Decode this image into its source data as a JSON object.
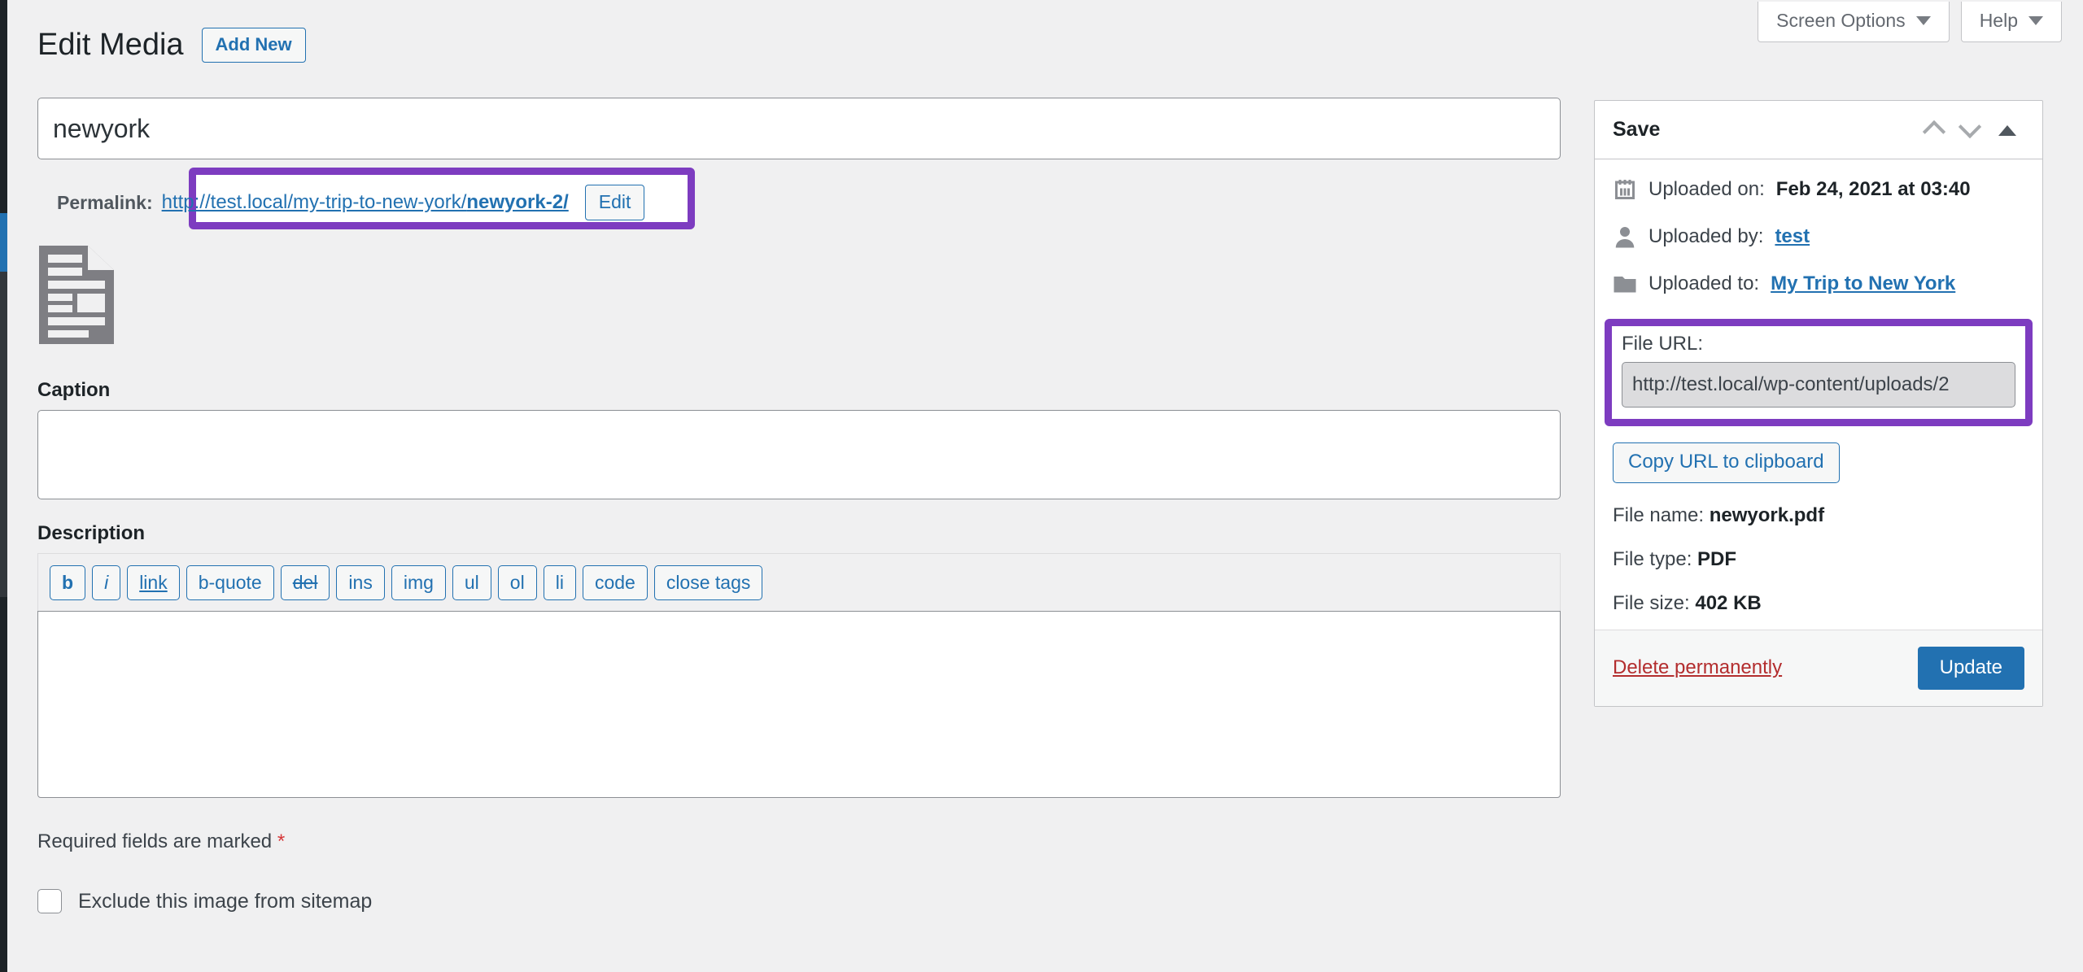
{
  "topbar": {
    "screen_options_label": "Screen Options",
    "help_label": "Help"
  },
  "header": {
    "page_title": "Edit Media",
    "add_new_label": "Add New"
  },
  "main": {
    "title_value": "newyork",
    "permalink_label": "Permalink:",
    "permalink_base": "http://test.local/my-trip-to-new-york/",
    "permalink_slug": "newyork-2/",
    "edit_permalink_label": "Edit",
    "caption_label": "Caption",
    "caption_value": "",
    "description_label": "Description",
    "quicktags": [
      "b",
      "i",
      "link",
      "b-quote",
      "del",
      "ins",
      "img",
      "ul",
      "ol",
      "li",
      "code",
      "close tags"
    ],
    "description_value": "",
    "required_note": "Required fields are marked",
    "required_star": "*",
    "sitemap_label": "Exclude this image from sitemap",
    "sitemap_checked": false
  },
  "sidebar": {
    "save_title": "Save",
    "uploaded_on_label": "Uploaded on:",
    "uploaded_on_value": "Feb 24, 2021 at 03:40",
    "uploaded_by_label": "Uploaded by:",
    "uploaded_by_value": "test",
    "uploaded_to_label": "Uploaded to:",
    "uploaded_to_value": "My Trip to New York",
    "file_url_label": "File URL:",
    "file_url_value": "http://test.local/wp-content/uploads/2",
    "copy_url_label": "Copy URL to clipboard",
    "file_name_label": "File name:",
    "file_name_value": "newyork.pdf",
    "file_type_label": "File type:",
    "file_type_value": "PDF",
    "file_size_label": "File size:",
    "file_size_value": "402 KB",
    "delete_label": "Delete permanently",
    "update_label": "Update"
  },
  "colors": {
    "highlight": "#7d3cc0",
    "accent": "#2271b1",
    "danger": "#b32d2e"
  }
}
